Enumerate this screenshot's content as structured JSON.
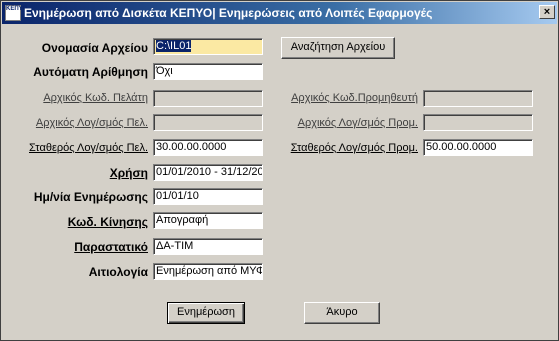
{
  "window": {
    "title": "Ενημέρωση από Δισκέτα ΚΕΠΥΟ| Ενημερώσεις από Λοιπές Εφαρμογές",
    "icon_label": "ΚΕΠΥΟ",
    "close_glyph": "×"
  },
  "form": {
    "filename_label": "Ονομασία Αρχείου",
    "filename_value": "C:\\IL01",
    "browse_button": "Αναζήτηση Αρχείου",
    "autonumber_label": "Αυτόματη Αρίθμηση",
    "autonumber_value": "Όχι",
    "customer_code_label": "Αρχικός Κωδ. Πελάτη",
    "supplier_code_label": "Αρχικός Κωδ.Προμηθευτή",
    "customer_account_label": "Αρχικός Λογ/σμός Πελ.",
    "supplier_account_label": "Αρχικός Λογ/σμός Προμ.",
    "fixed_customer_account_label": "Σταθερός Λογ/σμός Πελ.",
    "fixed_customer_account_value": "30.00.00.0000",
    "fixed_supplier_account_label": "Σταθερός Λογ/σμός Προμ.",
    "fixed_supplier_account_value": "50.00.00.0000",
    "fiscal_year_label": "Χρήση",
    "fiscal_year_value": "01/01/2010 - 31/12/20",
    "update_date_label": "Ημ/νία Ενημέρωσης",
    "update_date_value": "01/01/10",
    "movement_code_label": "Κωδ. Κίνησης",
    "movement_code_value": "Απογραφή",
    "document_label": "Παραστατικό",
    "document_value": "ΔΑ-ΤΙΜ",
    "reason_label": "Αιτιολογία",
    "reason_value": "Ενημέρωση από ΜΥΦ"
  },
  "buttons": {
    "update": "Ενημέρωση",
    "cancel": "Άκυρο"
  }
}
